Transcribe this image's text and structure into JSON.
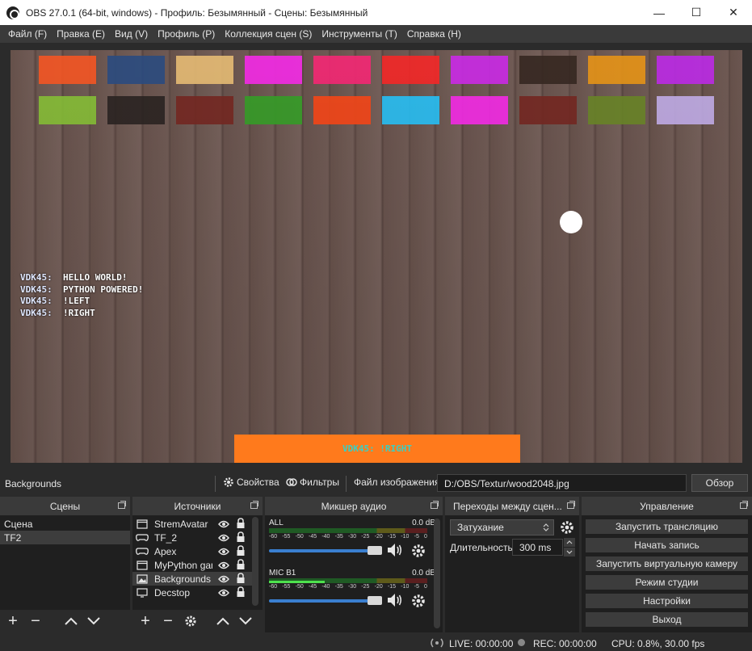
{
  "window": {
    "title": "OBS 27.0.1 (64-bit, windows) - Профиль: Безымянный - Сцены: Безымянный",
    "minimize": "—",
    "maximize": "☐",
    "close": "✕"
  },
  "menu": [
    "Файл (F)",
    "Правка (E)",
    "Вид (V)",
    "Профиль (P)",
    "Коллекция сцен (S)",
    "Инструменты (T)",
    "Справка (H)"
  ],
  "preview": {
    "brick_colors": [
      [
        "#ff5a26",
        "#2f4f86",
        "#f0c37a",
        "#ff2ef0",
        "#ff2a7a",
        "#ff2a2a",
        "#d42ef0",
        "#3a2a24",
        "#f09a1a",
        "#c42ef0"
      ],
      [
        "#8cc63a",
        "#2e2624",
        "#7a2a24",
        "#3aa42a",
        "#ff4a1a",
        "#2ac8ff",
        "#ff2ef0",
        "#7a2a24",
        "#6f8a2a",
        "#c9b3f0"
      ]
    ],
    "chat": [
      {
        "user": "VDK45:",
        "msg": "HELLO WORLD!"
      },
      {
        "user": "VDK45:",
        "msg": "PYTHON POWERED!"
      },
      {
        "user": "VDK45:",
        "msg": "!LEFT"
      },
      {
        "user": "VDK45:",
        "msg": "!RIGHT"
      }
    ],
    "paddle_text": "VDK45:   !RIGHT"
  },
  "source_toolbar": {
    "name": "Backgrounds",
    "properties": "Свойства",
    "filters": "Фильтры",
    "image_file_label": "Файл изображения",
    "path": "D:/OBS/Textur/wood2048.jpg",
    "browse": "Обзор"
  },
  "scenes": {
    "title": "Сцены",
    "items": [
      "Сцена",
      "TF2"
    ],
    "selected": 1
  },
  "sources": {
    "title": "Источники",
    "items": [
      {
        "name": "StremAvatar",
        "icon": "window-icon"
      },
      {
        "name": "TF_2",
        "icon": "gamepad-icon"
      },
      {
        "name": "Apex",
        "icon": "gamepad-icon"
      },
      {
        "name": "MyPython game",
        "icon": "window-icon"
      },
      {
        "name": "Backgrounds",
        "icon": "image-icon"
      },
      {
        "name": "Decstop",
        "icon": "monitor-icon"
      }
    ],
    "selected": 4
  },
  "mixer": {
    "title": "Микшер аудио",
    "ticks": [
      "-60",
      "-55",
      "-50",
      "-45",
      "-40",
      "-35",
      "-30",
      "-25",
      "-20",
      "-15",
      "-10",
      "-5",
      "0"
    ],
    "channels": [
      {
        "name": "ALL",
        "db": "0.0 dB",
        "level": 0.0
      },
      {
        "name": "MIC B1",
        "db": "0.0 dB",
        "level": 0.35
      }
    ]
  },
  "transitions": {
    "title": "Переходы между сцен...",
    "selected": "Затухание",
    "duration_label": "Длительность",
    "duration_value": "300 ms"
  },
  "controls": {
    "title": "Управление",
    "buttons": [
      "Запустить трансляцию",
      "Начать запись",
      "Запустить виртуальную камеру",
      "Режим студии",
      "Настройки",
      "Выход"
    ]
  },
  "status": {
    "live": "LIVE: 00:00:00",
    "rec": "REC: 00:00:00",
    "cpu": "CPU: 0.8%, 30.00 fps"
  }
}
